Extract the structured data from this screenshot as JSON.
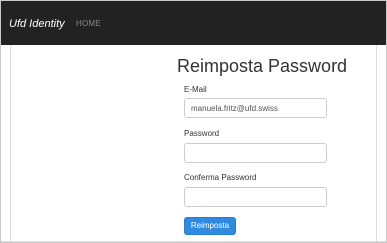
{
  "navbar": {
    "brand": "Ufd Identity",
    "links": [
      {
        "label": "HOME"
      }
    ]
  },
  "form": {
    "title": "Reimposta Password",
    "email": {
      "label": "E-Mail",
      "value": "manuela.fritz@ufd.swiss",
      "placeholder": ""
    },
    "password": {
      "label": "Password",
      "value": "",
      "placeholder": ""
    },
    "confirm_password": {
      "label": "Conferma Password",
      "value": "",
      "placeholder": ""
    },
    "submit_label": "Reimposta"
  },
  "colors": {
    "navbar_bg": "#222222",
    "brand_text": "#ffffff",
    "nav_link_text": "#888888",
    "primary_button": "#2f8ae0"
  }
}
